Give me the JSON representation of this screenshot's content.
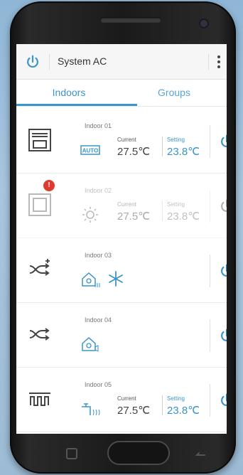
{
  "header": {
    "title": "System AC",
    "power_icon": "power-icon",
    "menu_icon": "more-vert-icon",
    "accent": "#3a95c8"
  },
  "tabs": [
    {
      "label": "Indoors",
      "active": true
    },
    {
      "label": "Groups",
      "active": false
    }
  ],
  "units": [
    {
      "name": "Indoor 01",
      "mode_icon": "indoor-unit-icon",
      "fan_icon": "auto-icon",
      "current_label": "Current",
      "current_value": "27.5℃",
      "setting_label": "Setting",
      "setting_value": "23.8℃",
      "power_icon": "power-icon",
      "enabled": true
    },
    {
      "name": "Indoor 02",
      "mode_icon": "cassette-unit-icon",
      "fan_icon": "sun-icon",
      "current_label": "Current",
      "current_value": "27.5℃",
      "setting_label": "Setting",
      "setting_value": "23.8℃",
      "power_icon": "power-icon",
      "enabled": false,
      "alert_badge": "!"
    },
    {
      "name": "Indoor 03",
      "mode_icon": "shuffle-add-icon",
      "fan_icon": "house-fan-heat-icon",
      "extra_icon": "snowflake-icon",
      "power_icon": "power-icon",
      "enabled": true
    },
    {
      "name": "Indoor 04",
      "mode_icon": "shuffle-icon",
      "fan_icon": "house-fan-sound-icon",
      "power_icon": "power-icon",
      "enabled": true
    },
    {
      "name": "Indoor 05",
      "mode_icon": "heater-coil-icon",
      "fan_icon": "faucet-heat-icon",
      "current_label": "Current",
      "current_value": "27.5℃",
      "setting_label": "Setting",
      "setting_value": "23.8℃",
      "power_icon": "power-icon",
      "enabled": true
    }
  ],
  "navbar": {
    "recent_icon": "recent-apps-icon",
    "home_icon": "home-button-icon",
    "back_icon": "back-icon"
  }
}
